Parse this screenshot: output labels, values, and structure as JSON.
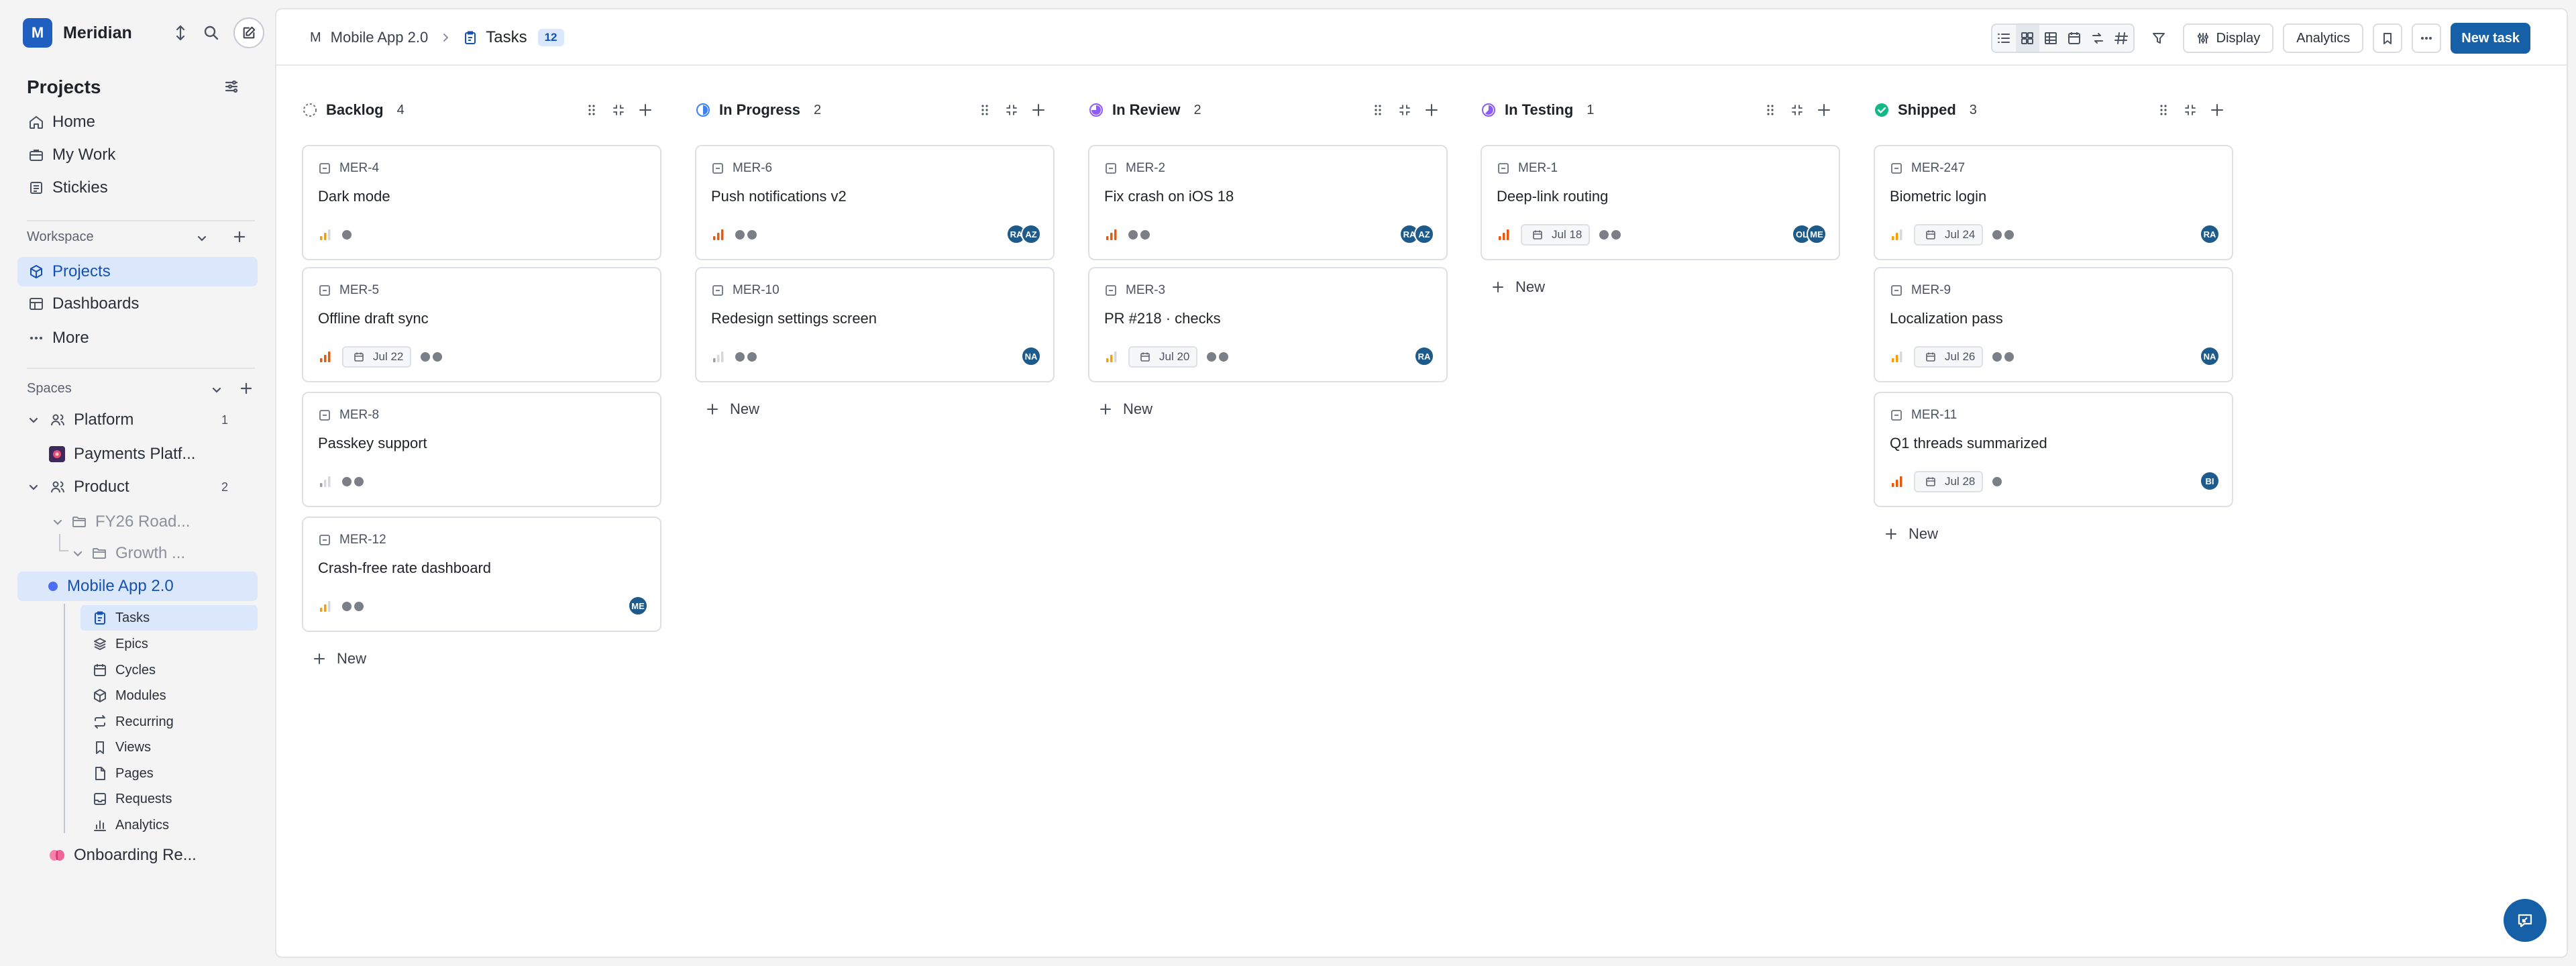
{
  "workspace": {
    "initial": "M",
    "name": "Meridian"
  },
  "sidebar": {
    "projects_title": "Projects",
    "nav": [
      {
        "label": "Home",
        "icon": "home-icon"
      },
      {
        "label": "My Work",
        "icon": "briefcase-icon"
      },
      {
        "label": "Stickies",
        "icon": "sticky-note-icon"
      }
    ],
    "workspace_label": "Workspace",
    "workspace_items": [
      {
        "label": "Projects",
        "icon": "projects-icon"
      },
      {
        "label": "Dashboards",
        "icon": "dashboard-icon"
      },
      {
        "label": "More",
        "icon": "more-icon"
      }
    ],
    "spaces_label": "Spaces",
    "spaces": {
      "platform": {
        "label": "Platform",
        "count": "1"
      },
      "payments": {
        "label": "Payments Platf..."
      },
      "product": {
        "label": "Product",
        "count": "2"
      },
      "fy26": {
        "label": "FY26 Road..."
      },
      "growth": {
        "label": "Growth ..."
      },
      "mobile": {
        "label": "Mobile App 2.0"
      },
      "onboarding": {
        "label": "Onboarding Re..."
      }
    },
    "mobile_items": [
      {
        "label": "Tasks",
        "icon": "tasks-icon"
      },
      {
        "label": "Epics",
        "icon": "layers-icon"
      },
      {
        "label": "Cycles",
        "icon": "calendar-icon"
      },
      {
        "label": "Modules",
        "icon": "cube-icon"
      },
      {
        "label": "Recurring",
        "icon": "repeat-icon"
      },
      {
        "label": "Views",
        "icon": "bookmark-icon"
      },
      {
        "label": "Pages",
        "icon": "page-icon"
      },
      {
        "label": "Requests",
        "icon": "inbox-icon"
      },
      {
        "label": "Analytics",
        "icon": "bar-chart-icon"
      }
    ]
  },
  "header": {
    "project_initial": "M",
    "project": "Mobile App 2.0",
    "page": "Tasks",
    "task_count": "12",
    "display_label": "Display",
    "analytics_label": "Analytics",
    "new_task_label": "New task"
  },
  "board": {
    "new_label": "New",
    "colors": {
      "urgent": "#e8590c",
      "medium": "#f59f00",
      "low": "#9aa0aa",
      "avatar": "#1e5a8a",
      "shipped": "#12b886",
      "progress": "#3b82f6",
      "review": "#8b5cf6"
    },
    "columns": [
      {
        "title": "Backlog",
        "count": "4",
        "status": "backlog",
        "cards": [
          {
            "id": "MER-4",
            "title": "Dark mode",
            "priority": "medium",
            "date": "",
            "dots": 1,
            "avatars": []
          },
          {
            "id": "MER-5",
            "title": "Offline draft sync",
            "priority": "urgent",
            "date": "Jul 22",
            "dots": 2,
            "avatars": []
          },
          {
            "id": "MER-8",
            "title": "Passkey support",
            "priority": "low",
            "date": "",
            "dots": 2,
            "avatars": []
          },
          {
            "id": "MER-12",
            "title": "Crash-free rate dashboard",
            "priority": "medium",
            "date": "",
            "dots": 2,
            "avatars": [
              "ME"
            ]
          }
        ]
      },
      {
        "title": "In Progress",
        "count": "2",
        "status": "progress",
        "cards": [
          {
            "id": "MER-6",
            "title": "Push notifications v2",
            "priority": "urgent",
            "date": "",
            "dots": 2,
            "avatars": [
              "RA",
              "AZ"
            ]
          },
          {
            "id": "MER-10",
            "title": "Redesign settings screen",
            "priority": "low",
            "date": "",
            "dots": 2,
            "avatars": [
              "NA"
            ]
          }
        ]
      },
      {
        "title": "In Review",
        "count": "2",
        "status": "review",
        "cards": [
          {
            "id": "MER-2",
            "title": "Fix crash on iOS 18",
            "priority": "urgent",
            "date": "",
            "dots": 2,
            "avatars": [
              "RA",
              "AZ"
            ]
          },
          {
            "id": "MER-3",
            "title": "PR #218 · checks",
            "priority": "medium",
            "date": "Jul 20",
            "dots": 2,
            "avatars": [
              "RA"
            ]
          }
        ]
      },
      {
        "title": "In Testing",
        "count": "1",
        "status": "testing",
        "cards": [
          {
            "id": "MER-1",
            "title": "Deep-link routing",
            "priority": "urgent",
            "date": "Jul 18",
            "dots": 2,
            "avatars": [
              "OL",
              "ME"
            ]
          }
        ]
      },
      {
        "title": "Shipped",
        "count": "3",
        "status": "shipped",
        "cards": [
          {
            "id": "MER-247",
            "title": "Biometric login",
            "priority": "medium",
            "date": "Jul 24",
            "dots": 2,
            "avatars": [
              "RA"
            ]
          },
          {
            "id": "MER-9",
            "title": "Localization pass",
            "priority": "medium",
            "date": "Jul 26",
            "dots": 2,
            "avatars": [
              "NA"
            ]
          },
          {
            "id": "MER-11",
            "title": "Q1 threads summarized",
            "priority": "urgent",
            "date": "Jul 28",
            "dots": 1,
            "avatars": [
              "BI"
            ]
          }
        ]
      }
    ]
  }
}
